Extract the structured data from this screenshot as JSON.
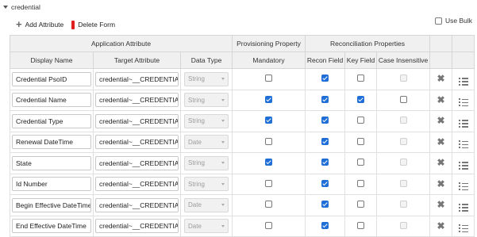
{
  "section": {
    "title": "credential"
  },
  "toolbar": {
    "add_label": "Add Attribute",
    "delete_label": "Delete Form"
  },
  "use_bulk": {
    "label": "Use Bulk",
    "checked": false
  },
  "header": {
    "group_app": "Application Attribute",
    "group_prov": "Provisioning Property",
    "group_recon": "Reconciliation Properties",
    "col_display": "Display Name",
    "col_target": "Target Attribute",
    "col_type": "Data Type",
    "col_mandatory": "Mandatory",
    "col_recon": "Recon Field",
    "col_key": "Key Field",
    "col_case": "Case Insensitive"
  },
  "rows": [
    {
      "display": "Credential PsoID",
      "target": "credential~__CREDENTIAI",
      "type": "String",
      "mandatory": false,
      "recon": true,
      "key": false,
      "case": false,
      "case_disabled": true
    },
    {
      "display": "Credential Name",
      "target": "credential~__CREDENTIAI",
      "type": "String",
      "mandatory": true,
      "recon": true,
      "key": true,
      "case": false,
      "case_disabled": false
    },
    {
      "display": "Credential Type",
      "target": "credential~__CREDENTIAI",
      "type": "String",
      "mandatory": true,
      "recon": true,
      "key": false,
      "case": false,
      "case_disabled": true
    },
    {
      "display": "Renewal DateTime",
      "target": "credential~__CREDENTIAI",
      "type": "Date",
      "mandatory": false,
      "recon": true,
      "key": false,
      "case": false,
      "case_disabled": true
    },
    {
      "display": "State",
      "target": "credential~__CREDENTIAI",
      "type": "String",
      "mandatory": true,
      "recon": true,
      "key": false,
      "case": false,
      "case_disabled": true
    },
    {
      "display": "Id Number",
      "target": "credential~__CREDENTIAI",
      "type": "String",
      "mandatory": false,
      "recon": true,
      "key": false,
      "case": false,
      "case_disabled": true
    },
    {
      "display": "Begin Effective DateTime",
      "target": "credential~__CREDENTIAI",
      "type": "Date",
      "mandatory": false,
      "recon": true,
      "key": false,
      "case": false,
      "case_disabled": true
    },
    {
      "display": "End Effective DateTime",
      "target": "credential~__CREDENTIAI",
      "type": "Date",
      "mandatory": false,
      "recon": true,
      "key": false,
      "case": false,
      "case_disabled": true
    }
  ]
}
